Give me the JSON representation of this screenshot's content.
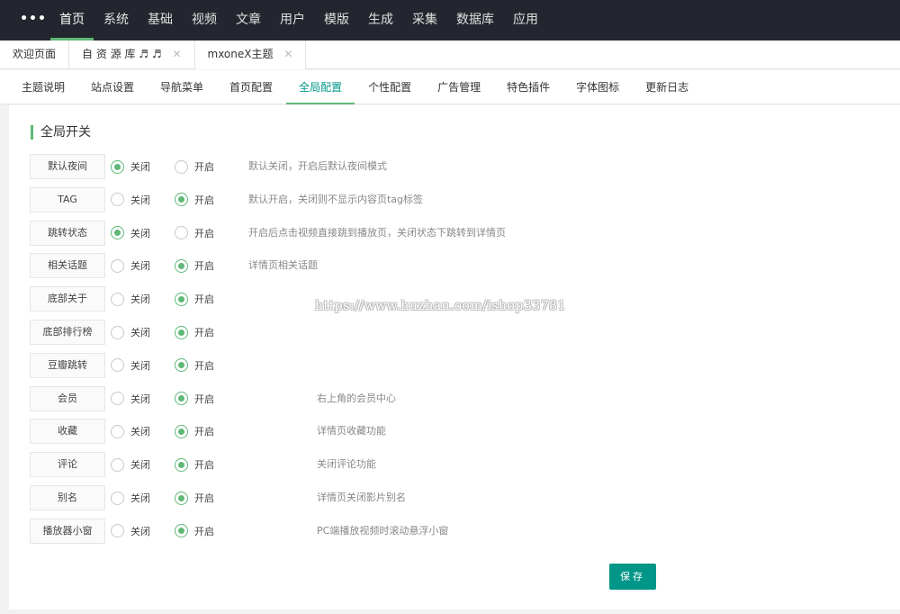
{
  "topnav": {
    "more_icon": "•••",
    "items": [
      {
        "label": "首页",
        "active": true
      },
      {
        "label": "系统"
      },
      {
        "label": "基础"
      },
      {
        "label": "视频"
      },
      {
        "label": "文章"
      },
      {
        "label": "用户"
      },
      {
        "label": "模版"
      },
      {
        "label": "生成"
      },
      {
        "label": "采集"
      },
      {
        "label": "数据库"
      },
      {
        "label": "应用"
      }
    ]
  },
  "tabs": [
    {
      "label": "欢迎页面",
      "closable": false
    },
    {
      "label": "自 资 源 库 ♬ ♬",
      "closable": true,
      "close": "✕"
    },
    {
      "label": "mxoneX主题",
      "closable": true,
      "close": "✕",
      "active": true
    }
  ],
  "subtabs": [
    {
      "label": "主题说明"
    },
    {
      "label": "站点设置"
    },
    {
      "label": "导航菜单"
    },
    {
      "label": "首页配置"
    },
    {
      "label": "全局配置",
      "active": true
    },
    {
      "label": "个性配置"
    },
    {
      "label": "广告管理"
    },
    {
      "label": "特色插件"
    },
    {
      "label": "字体图标"
    },
    {
      "label": "更新日志"
    }
  ],
  "section": {
    "title": "全局开关"
  },
  "option_labels": {
    "off": "关闭",
    "on": "开启"
  },
  "settings": [
    {
      "label": "默认夜间",
      "value": "off",
      "desc": "默认关闭，开启后默认夜间模式"
    },
    {
      "label": "TAG",
      "value": "on",
      "desc": "默认开启，关闭则不显示内容页tag标签"
    },
    {
      "label": "跳转状态",
      "value": "off",
      "desc": "开启后点击视频直接跳到播放页，关闭状态下跳转到详情页"
    },
    {
      "label": "相关话题",
      "value": "on",
      "desc": "详情页相关话题"
    },
    {
      "label": "底部关于",
      "value": "on",
      "desc": ""
    },
    {
      "label": "底部排行榜",
      "value": "on",
      "desc": ""
    },
    {
      "label": "豆瓣跳转",
      "value": "on",
      "desc": ""
    },
    {
      "label": "会员",
      "value": "on",
      "desc": "右上角的会员中心"
    },
    {
      "label": "收藏",
      "value": "on",
      "desc": "详情页收藏功能"
    },
    {
      "label": "评论",
      "value": "on",
      "desc": "关闭评论功能"
    },
    {
      "label": "别名",
      "value": "on",
      "desc": "详情页关闭影片别名"
    },
    {
      "label": "播放器小窗",
      "value": "on",
      "desc": "PC端播放视频时滚动悬浮小窗"
    }
  ],
  "watermark": "https://www.huzhan.com/ishop33781",
  "save_label": "保存",
  "colors": {
    "accent": "#5fb878",
    "button": "#009688",
    "topbar": "#23262e"
  }
}
